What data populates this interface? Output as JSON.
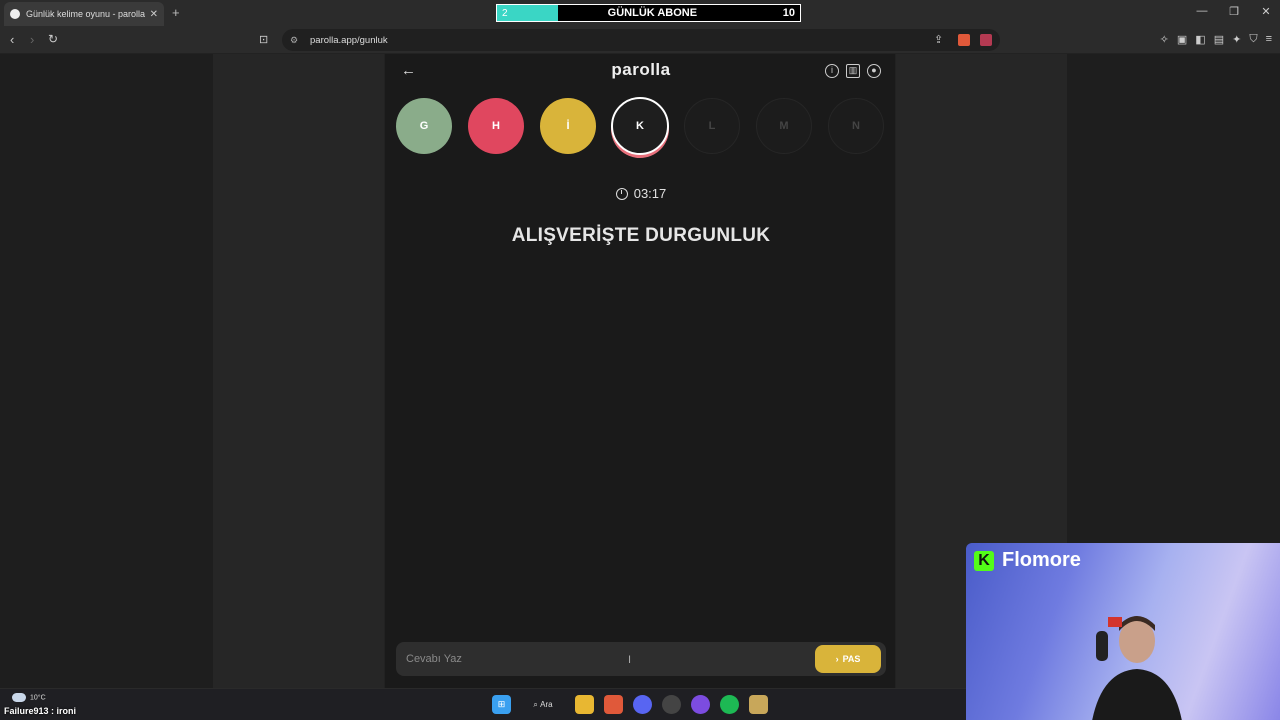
{
  "browser": {
    "tab_title": "Günlük kelime oyunu - parolla",
    "tab_close": "✕",
    "new_tab": "+",
    "url": "parolla.app/gunluk"
  },
  "abone_bar": {
    "current": "2",
    "label": "GÜNLÜK ABONE",
    "goal": "10",
    "progress": 0.2,
    "fill_color": "#3ad6c5"
  },
  "app": {
    "logo": "parolla",
    "letters": [
      {
        "char": "G",
        "state": "correct",
        "color": "#8aac8a"
      },
      {
        "char": "H",
        "state": "wrong",
        "color": "#e0475f"
      },
      {
        "char": "İ",
        "state": "passed",
        "color": "#d9b43a"
      },
      {
        "char": "K",
        "state": "active",
        "color": "#1e1e1e"
      },
      {
        "char": "L",
        "state": "future",
        "color": "#1c1c1c"
      },
      {
        "char": "M",
        "state": "future",
        "color": "#1c1c1c"
      },
      {
        "char": "N",
        "state": "future",
        "color": "#1c1c1c"
      }
    ],
    "timer": "03:17",
    "clue": "ALIŞVERİŞTE DURGUNLUK",
    "answer_placeholder": "Cevabı Yaz",
    "pass_label": "PAS"
  },
  "taskbar": {
    "temperature": "10°C",
    "search_label": "Ara",
    "ticker": "Failure913 : ironi"
  },
  "webcam": {
    "streamer_name": "Flomore",
    "platform_icon": "K"
  },
  "colors": {
    "correct": "#8aac8a",
    "wrong": "#e0475f",
    "passed": "#d9b43a",
    "accent": "#d9b43a"
  }
}
